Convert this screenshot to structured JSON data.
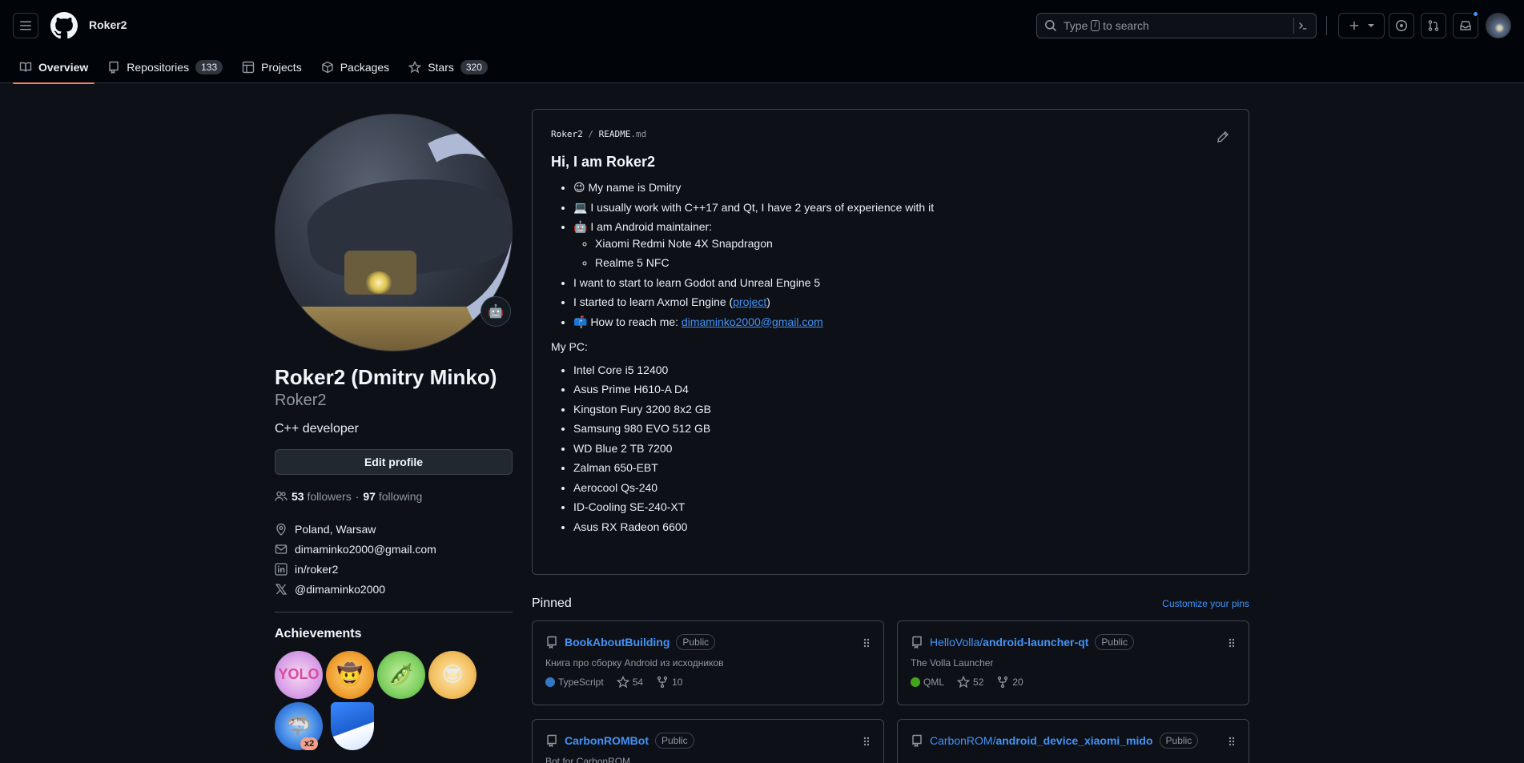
{
  "header": {
    "username": "Roker2",
    "search": {
      "prefix": "Type",
      "key": "/",
      "suffix": "to search"
    }
  },
  "tabs": [
    {
      "label": "Overview"
    },
    {
      "label": "Repositories",
      "count": "133"
    },
    {
      "label": "Projects"
    },
    {
      "label": "Packages"
    },
    {
      "label": "Stars",
      "count": "320"
    }
  ],
  "profile": {
    "name": "Roker2 (Dmitry Minko)",
    "login": "Roker2",
    "bio": "C++ developer",
    "edit_label": "Edit profile",
    "followers_count": "53",
    "followers_label": "followers",
    "separator": "·",
    "following_count": "97",
    "following_label": "following",
    "location": "Poland, Warsaw",
    "email": "dimaminko2000@gmail.com",
    "linkedin": "in/roker2",
    "twitter": "@dimaminko2000",
    "status_emoji": "🤖"
  },
  "achievements": {
    "title": "Achievements",
    "badges": [
      "YOLO",
      "Pull Shark (cowboy)",
      "Pair Extraordinaire",
      "Quickdraw",
      "Pull Shark",
      "Arctic Code Vault"
    ],
    "multiplier": "x2"
  },
  "readme": {
    "owner": "Roker2",
    "slash": "/",
    "file": "README",
    "ext": ".md",
    "heading": "Hi, I am Roker2",
    "items": {
      "name": "😉 My name is Dmitry",
      "work": "💻 I usually work with C++17 and Qt, I have 2 years of experience with it",
      "android": "🤖 I am Android maintainer:",
      "device1": "Xiaomi Redmi Note 4X Snapdragon",
      "device2": "Realme 5 NFC",
      "godot": "I want to start to learn Godot and Unreal Engine 5",
      "axmol_prefix": "I started to learn Axmol Engine (",
      "axmol_link": "project",
      "axmol_suffix": ")",
      "reach_prefix": "📫 How to reach me: ",
      "reach_link": "dimaminko2000@gmail.com"
    },
    "pc_label": "My PC:",
    "pc": [
      "Intel Core i5 12400",
      "Asus Prime H610-A D4",
      "Kingston Fury 3200 8x2 GB",
      "Samsung 980 EVO 512 GB",
      "WD Blue 2 TB 7200",
      "Zalman 650-EBT",
      "Aerocool Qs-240",
      "ID-Cooling SE-240-XT",
      "Asus RX Radeon 6600"
    ]
  },
  "pinned": {
    "title": "Pinned",
    "customize": "Customize your pins",
    "repos": [
      {
        "owner": "",
        "name": "BookAboutBuilding",
        "visibility": "Public",
        "description": "Книга про сборку Android из исходников",
        "language": "TypeScript",
        "lang_color": "#3178c6",
        "stars": "54",
        "forks": "10"
      },
      {
        "owner": "HelloVolla/",
        "name": "android-launcher-qt",
        "visibility": "Public",
        "description": "The Volla Launcher",
        "language": "QML",
        "lang_color": "#44a51c",
        "stars": "52",
        "forks": "20"
      },
      {
        "owner": "",
        "name": "CarbonROMBot",
        "visibility": "Public",
        "description": "Bot for CarbonROM"
      },
      {
        "owner": "CarbonROM/",
        "name": "android_device_xiaomi_mido",
        "visibility": "Public"
      }
    ]
  }
}
